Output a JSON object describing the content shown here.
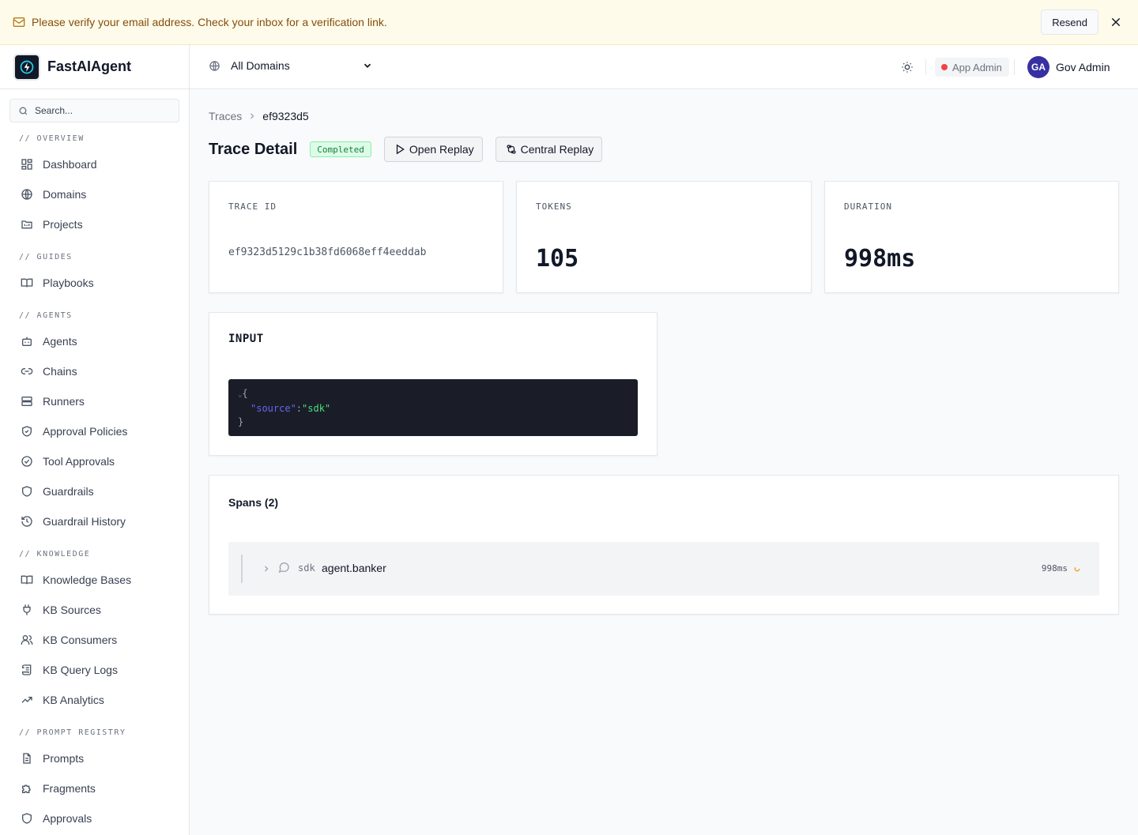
{
  "banner": {
    "message": "Please verify your email address. Check your inbox for a verification link.",
    "resend_label": "Resend",
    "icon": "mail-icon",
    "close_icon": "close-icon"
  },
  "brand": {
    "name": "FastAIAgent",
    "icon": "bolt-icon"
  },
  "search": {
    "placeholder": "Search..."
  },
  "sidebar": {
    "sections": [
      {
        "label": "// OVERVIEW",
        "items": [
          {
            "label": "Dashboard",
            "icon": "grid-icon"
          },
          {
            "label": "Domains",
            "icon": "globe-icon"
          },
          {
            "label": "Projects",
            "icon": "folder-icon"
          }
        ]
      },
      {
        "label": "// GUIDES",
        "items": [
          {
            "label": "Playbooks",
            "icon": "book-icon"
          }
        ]
      },
      {
        "label": "// AGENTS",
        "items": [
          {
            "label": "Agents",
            "icon": "bot-icon"
          },
          {
            "label": "Chains",
            "icon": "link-icon"
          },
          {
            "label": "Runners",
            "icon": "server-icon"
          },
          {
            "label": "Approval Policies",
            "icon": "shield-check-icon"
          },
          {
            "label": "Tool Approvals",
            "icon": "check-circle-icon"
          },
          {
            "label": "Guardrails",
            "icon": "shield-icon"
          },
          {
            "label": "Guardrail History",
            "icon": "history-icon"
          }
        ]
      },
      {
        "label": "// KNOWLEDGE",
        "items": [
          {
            "label": "Knowledge Bases",
            "icon": "book-open-icon"
          },
          {
            "label": "KB Sources",
            "icon": "plug-icon"
          },
          {
            "label": "KB Consumers",
            "icon": "users-icon"
          },
          {
            "label": "KB Query Logs",
            "icon": "scroll-icon"
          },
          {
            "label": "KB Analytics",
            "icon": "trending-up-icon"
          }
        ]
      },
      {
        "label": "// PROMPT REGISTRY",
        "items": [
          {
            "label": "Prompts",
            "icon": "file-text-icon"
          },
          {
            "label": "Fragments",
            "icon": "puzzle-icon"
          },
          {
            "label": "Approvals",
            "icon": "shield-icon"
          }
        ]
      }
    ]
  },
  "topbar": {
    "domain_selector": "All Domains",
    "role_badge": "App Admin",
    "user": {
      "initials": "GA",
      "name": "Gov Admin"
    },
    "accent": "#3730a3"
  },
  "breadcrumb": {
    "parent": "Traces",
    "current": "ef9323d5"
  },
  "page": {
    "title": "Trace Detail",
    "status": "Completed",
    "open_replay_label": "Open Replay",
    "central_replay_label": "Central Replay"
  },
  "stats": {
    "trace_id_label": "TRACE ID",
    "trace_id_value": "ef9323d5129c1b38fd6068eff4eeddab",
    "tokens_label": "TOKENS",
    "tokens_value": "105",
    "duration_label": "DURATION",
    "duration_value": "998ms"
  },
  "input": {
    "heading": "INPUT",
    "code": {
      "open": "{",
      "key": "\"source\"",
      "colon": ":",
      "value": "\"sdk\"",
      "close": "}"
    }
  },
  "spans": {
    "heading": "Spans (2)",
    "rows": [
      {
        "source": "sdk",
        "name": "agent.banker",
        "duration": "998ms"
      }
    ]
  }
}
